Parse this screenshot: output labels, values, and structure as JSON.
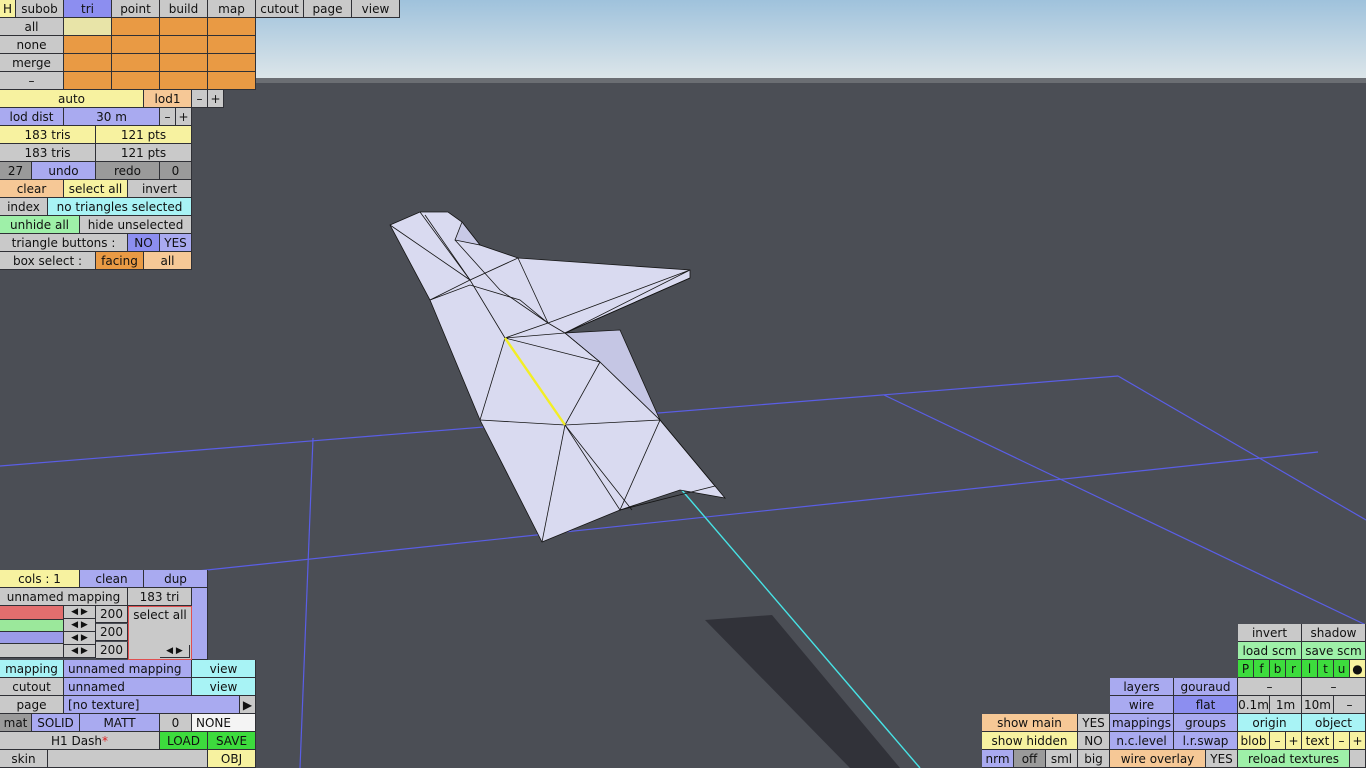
{
  "toolbar": {
    "h_label": "H",
    "tabs": [
      "subob",
      "tri",
      "point",
      "build",
      "map",
      "cutout",
      "page",
      "view"
    ],
    "active_tab": "tri"
  },
  "selection_grid": {
    "rows": [
      "all",
      "none",
      "merge",
      "–"
    ]
  },
  "lod": {
    "auto_label": "auto",
    "lod_label": "lod1",
    "minus": "–",
    "plus": "+",
    "dist_label": "lod dist",
    "dist_value": "30 m"
  },
  "stats": {
    "tris_a": "183 tris",
    "pts_a": "121 pts",
    "tris_b": "183 tris",
    "pts_b": "121 pts"
  },
  "history": {
    "undo_count": "27",
    "undo_label": "undo",
    "redo_label": "redo",
    "redo_count": "0"
  },
  "actions": {
    "clear": "clear",
    "select_all": "select all",
    "invert": "invert",
    "index": "index",
    "selection_status": "no triangles selected",
    "unhide_all": "unhide all",
    "hide_unselected": "hide unselected",
    "triangle_buttons_label": "triangle buttons :",
    "tb_no": "NO",
    "tb_yes": "YES",
    "box_select_label": "box select :",
    "bs_facing": "facing",
    "bs_all": "all"
  },
  "mapping_panel": {
    "cols": "cols : 1",
    "clean": "clean",
    "dup": "dup",
    "mapping_name": "unnamed mapping",
    "tri_count": "183 tri",
    "rgb_values": [
      "200",
      "200",
      "200"
    ],
    "select_all": "select all",
    "mapping_label": "mapping",
    "mapping_value": "unnamed mapping",
    "view1": "view",
    "cutout_label": "cutout",
    "cutout_value": "unnamed",
    "view2": "view",
    "page_label": "page",
    "page_value": "[no texture]",
    "page_arrow": "▶",
    "mat": "mat",
    "solid": "SOLID",
    "matt": "MATT",
    "mat_num": "0",
    "none": "NONE",
    "model_name": "H1 Dash",
    "modified_mark": "*",
    "load": "LOAD",
    "save": "SAVE",
    "skin": "skin",
    "obj": "OBJ"
  },
  "view_panel": {
    "invert": "invert",
    "shadow": "shadow",
    "load_scm": "load scm",
    "save_scm": "save scm",
    "letters": [
      "P",
      "f",
      "b",
      "r",
      "l",
      "t",
      "u",
      "●"
    ],
    "layers": "layers",
    "gouraud": "gouraud",
    "dash1": "–",
    "dash2": "–",
    "wire": "wire",
    "flat": "flat",
    "s01": "0.1m",
    "s1": "1m",
    "s10": "10m",
    "dash3": "–",
    "show_main": "show main",
    "show_main_val": "YES",
    "mappings": "mappings",
    "groups": "groups",
    "origin": "origin",
    "object": "object",
    "show_hidden": "show hidden",
    "show_hidden_val": "NO",
    "nc_level": "n.c.level",
    "lr_swap": "l.r.swap",
    "blob": "blob",
    "blob_minus": "–",
    "blob_plus": "+",
    "text": "text",
    "text_minus": "–",
    "text_plus": "+",
    "nrm": "nrm",
    "off": "off",
    "sml": "sml",
    "big": "big",
    "wire_overlay": "wire overlay",
    "wire_overlay_val": "YES",
    "reload_textures": "reload textures"
  },
  "colors": {
    "sky": "#c7dbe8",
    "ground": "#4a4d54",
    "grid": "#5a5ee6",
    "axis": "#47e3e6",
    "mesh": "#d9daf0",
    "selected_edge": "#f2ee25"
  }
}
